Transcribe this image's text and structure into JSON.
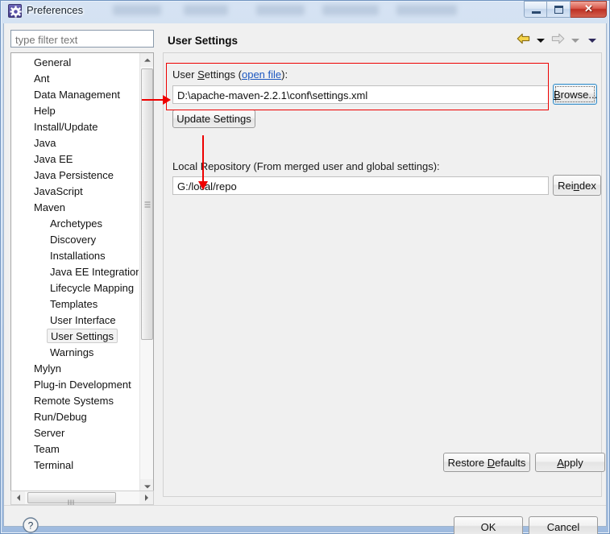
{
  "window": {
    "title": "Preferences",
    "icon": "gear-icon",
    "minimize_label": "",
    "maximize_label": "",
    "close_label": "✕"
  },
  "filter": {
    "placeholder": "type filter text",
    "value": ""
  },
  "tree": {
    "items": [
      {
        "label": "General",
        "depth": 0,
        "selected": false
      },
      {
        "label": "Ant",
        "depth": 0,
        "selected": false
      },
      {
        "label": "Data Management",
        "depth": 0,
        "selected": false
      },
      {
        "label": "Help",
        "depth": 0,
        "selected": false
      },
      {
        "label": "Install/Update",
        "depth": 0,
        "selected": false
      },
      {
        "label": "Java",
        "depth": 0,
        "selected": false
      },
      {
        "label": "Java EE",
        "depth": 0,
        "selected": false
      },
      {
        "label": "Java Persistence",
        "depth": 0,
        "selected": false
      },
      {
        "label": "JavaScript",
        "depth": 0,
        "selected": false
      },
      {
        "label": "Maven",
        "depth": 0,
        "selected": false
      },
      {
        "label": "Archetypes",
        "depth": 1,
        "selected": false
      },
      {
        "label": "Discovery",
        "depth": 1,
        "selected": false
      },
      {
        "label": "Installations",
        "depth": 1,
        "selected": false
      },
      {
        "label": "Java EE Integration",
        "depth": 1,
        "selected": false
      },
      {
        "label": "Lifecycle Mapping",
        "depth": 1,
        "selected": false
      },
      {
        "label": "Templates",
        "depth": 1,
        "selected": false
      },
      {
        "label": "User Interface",
        "depth": 1,
        "selected": false
      },
      {
        "label": "User Settings",
        "depth": 1,
        "selected": true
      },
      {
        "label": "Warnings",
        "depth": 1,
        "selected": false
      },
      {
        "label": "Mylyn",
        "depth": 0,
        "selected": false
      },
      {
        "label": "Plug-in Development",
        "depth": 0,
        "selected": false
      },
      {
        "label": "Remote Systems",
        "depth": 0,
        "selected": false
      },
      {
        "label": "Run/Debug",
        "depth": 0,
        "selected": false
      },
      {
        "label": "Server",
        "depth": 0,
        "selected": false
      },
      {
        "label": "Team",
        "depth": 0,
        "selected": false
      },
      {
        "label": "Terminal",
        "depth": 0,
        "selected": false
      }
    ]
  },
  "page": {
    "title": "User Settings",
    "nav": {
      "back_icon": "back-arrow-icon",
      "back_menu_icon": "chevron-down-icon",
      "forward_icon": "forward-arrow-icon",
      "forward_menu_icon": "chevron-down-icon",
      "history_menu_icon": "chevron-down-icon"
    },
    "user_settings": {
      "label_prefix": "User ",
      "label_mnemonic": "S",
      "label_suffix": "ettings (",
      "link_text": "open file",
      "label_end": "):",
      "value": "D:\\apache-maven-2.2.1\\conf\\settings.xml",
      "browse_label_mnemonic": "B",
      "browse_label_rest": "rowse...",
      "update_label": "Update Settings"
    },
    "local_repository": {
      "label": "Local Repository (From merged user and global settings):",
      "value": "G:/local/repo",
      "reindex_prefix": "Rei",
      "reindex_mnemonic": "n",
      "reindex_suffix": "dex"
    },
    "restore_defaults": {
      "prefix": "Restore ",
      "mnemonic": "D",
      "suffix": "efaults"
    },
    "apply": {
      "mnemonic": "A",
      "suffix": "pply"
    }
  },
  "dialog": {
    "help_icon": "help-question-icon",
    "ok_label": "OK",
    "cancel_label": "Cancel"
  },
  "annotations": {
    "color": "#ee0000",
    "highlight_box": "user-settings-field-group",
    "arrow_1": "points-right-to-user-settings-field",
    "arrow_2": "points-down-to-local-repository-field"
  }
}
